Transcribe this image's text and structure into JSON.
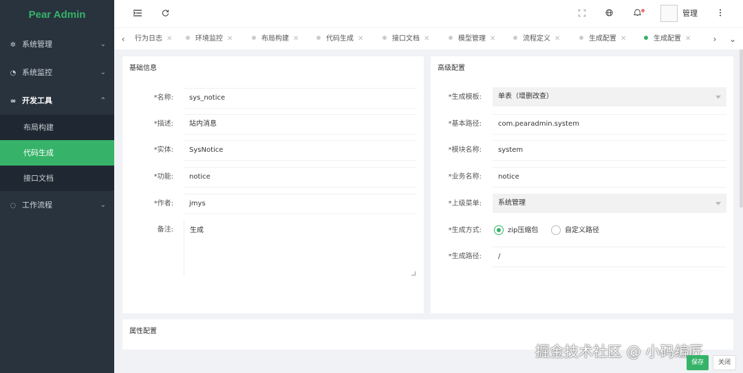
{
  "app": {
    "title": "Pear Admin"
  },
  "colors": {
    "accent": "#36b368",
    "sidebar_bg": "#28333e",
    "submenu_bg": "#1f2832"
  },
  "sidebar": {
    "items": [
      {
        "label": "系统管理",
        "icon": "gear-icon",
        "chevron": "chevron-down-icon"
      },
      {
        "label": "系统监控",
        "icon": "dashboard-icon",
        "chevron": "chevron-down-icon"
      },
      {
        "label": "开发工具",
        "icon": "tools-icon",
        "chevron": "chevron-up-icon",
        "open": true,
        "children": [
          {
            "label": "布局构建"
          },
          {
            "label": "代码生成",
            "active": true
          },
          {
            "label": "接口文档"
          }
        ]
      },
      {
        "label": "工作流程",
        "icon": "workflow-icon",
        "chevron": "chevron-down-icon"
      }
    ]
  },
  "header": {
    "icons": [
      "menu-toggle-icon",
      "refresh-icon",
      "fullscreen-icon",
      "globe-icon",
      "bell-icon",
      "more-icon"
    ],
    "user_name": "管理"
  },
  "tabs": {
    "items": [
      {
        "label": "行为日志"
      },
      {
        "label": "环境监控"
      },
      {
        "label": "布局构建"
      },
      {
        "label": "代码生成"
      },
      {
        "label": "接口文档"
      },
      {
        "label": "模型管理"
      },
      {
        "label": "流程定义"
      },
      {
        "label": "生成配置"
      },
      {
        "label": "生成配置",
        "active": true
      }
    ],
    "close_glyph": "✕"
  },
  "basic": {
    "title": "基础信息",
    "name_label": "*名称:",
    "name_value": "sys_notice",
    "desc_label": "*描述:",
    "desc_value": "站内消息",
    "entity_label": "*实体:",
    "entity_value": "SysNotice",
    "func_label": "*功能:",
    "func_value": "notice",
    "author_label": "*作者:",
    "author_value": "jmys",
    "remark_label": "备注:",
    "remark_value": "生成"
  },
  "advanced": {
    "title": "高级配置",
    "template_label": "*生成模板:",
    "template_value": "单表（增删改查）",
    "base_path_label": "*基本路径:",
    "base_path_value": "com.pearadmin.system",
    "module_label": "*模块名称:",
    "module_value": "system",
    "business_label": "*业务名称:",
    "business_value": "notice",
    "parent_menu_label": "*上级菜单:",
    "parent_menu_value": "系统管理",
    "gen_mode_label": "*生成方式:",
    "gen_mode_options": [
      "zip压缩包",
      "自定义路径"
    ],
    "gen_mode_selected": "zip压缩包",
    "gen_path_label": "*生成路径:",
    "gen_path_value": "/"
  },
  "props": {
    "title": "属性配置"
  },
  "footer": {
    "save_label": "保存",
    "close_label": "关闭"
  },
  "watermark": "掘金技术社区 @ 小码编匠"
}
